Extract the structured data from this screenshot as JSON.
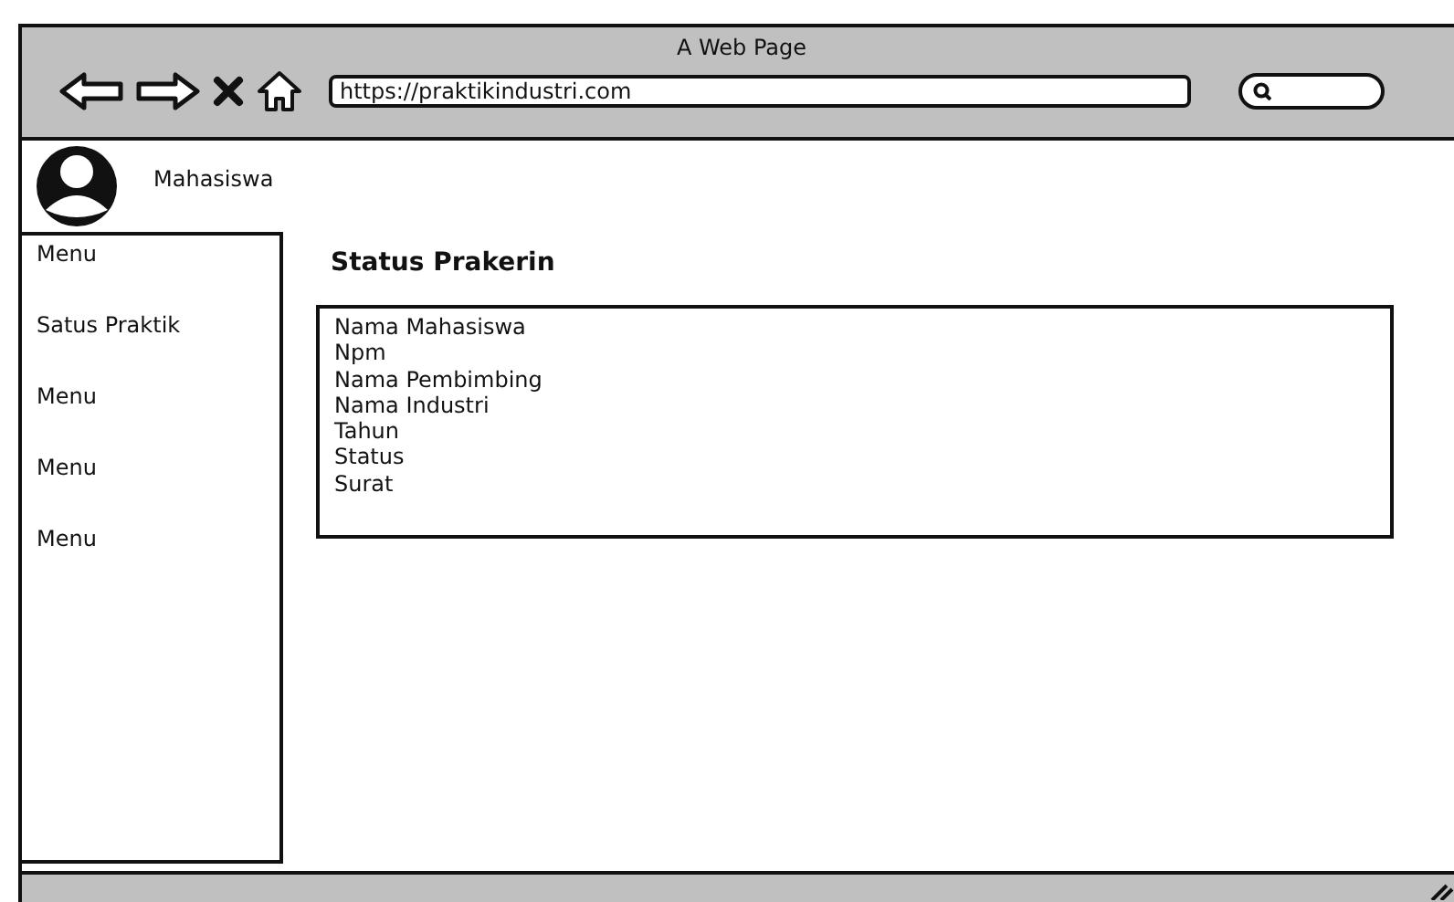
{
  "window": {
    "title": "A Web Page"
  },
  "browser": {
    "url": "https://praktikindustri.com"
  },
  "user": {
    "name": "Mahasiswa"
  },
  "sidebar": {
    "items": [
      {
        "label": "Menu"
      },
      {
        "label": "Satus Praktik"
      },
      {
        "label": "Menu"
      },
      {
        "label": "Menu"
      },
      {
        "label": "Menu"
      }
    ]
  },
  "main": {
    "heading": "Status Prakerin",
    "fields": [
      "Nama Mahasiswa",
      "Npm",
      "Nama Pembimbing",
      "Nama Industri",
      "Tahun",
      "Status",
      "Surat"
    ]
  }
}
